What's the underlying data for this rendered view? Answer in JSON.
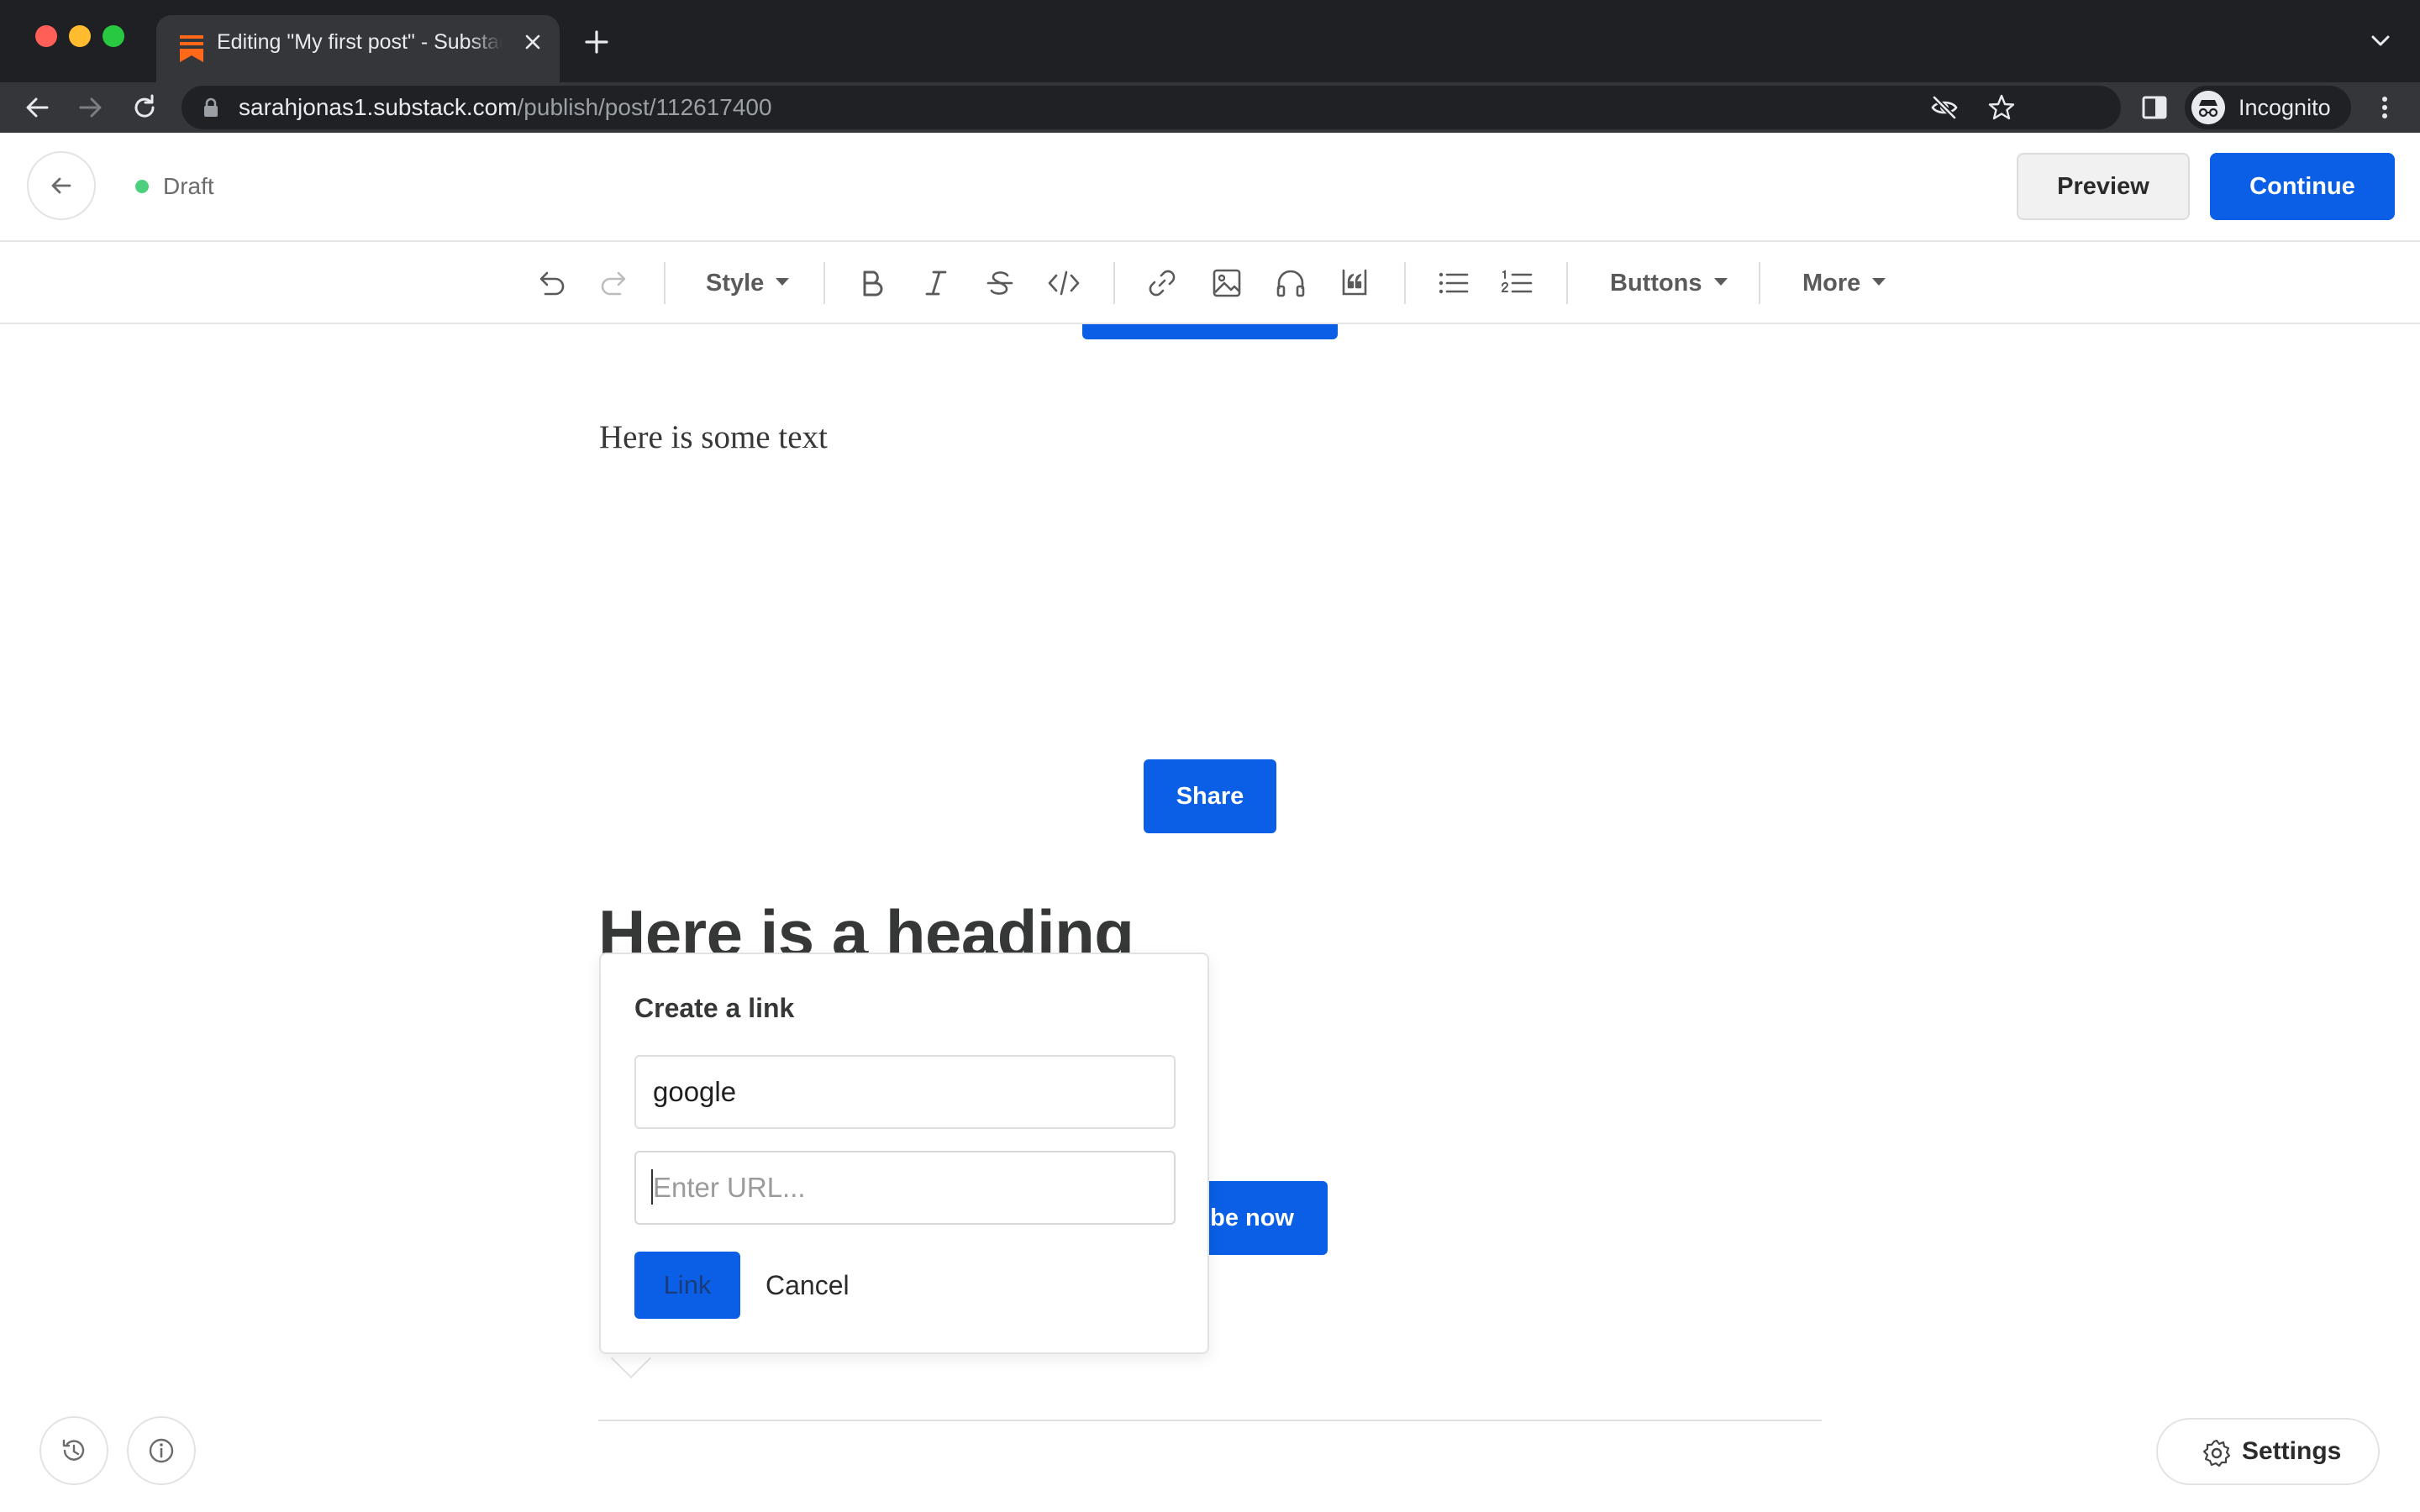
{
  "browser": {
    "tab_title": "Editing \"My first post\" - Substack",
    "url_host": "sarahjonas1.substack.com",
    "url_path": "/publish/post/112617400",
    "profile_label": "Incognito"
  },
  "header": {
    "status": "Draft",
    "preview_label": "Preview",
    "continue_label": "Continue"
  },
  "toolbar": {
    "style_label": "Style",
    "buttons_label": "Buttons",
    "more_label": "More"
  },
  "content": {
    "paragraph": "Here is some text",
    "share_label": "Share",
    "heading": "Here is a heading",
    "subscribe_visible": "ibe now"
  },
  "link_popover": {
    "title": "Create a link",
    "text_value": "google",
    "url_placeholder": "Enter URL...",
    "link_label": "Link",
    "cancel_label": "Cancel"
  },
  "footer": {
    "settings_label": "Settings"
  },
  "colors": {
    "accent": "#0a5fe6",
    "draft_dot": "#4cd07d",
    "chrome_dark": "#1f2023"
  },
  "icons": [
    "substack-logo-icon",
    "close-icon",
    "plus-icon",
    "chevron-down-icon",
    "back-arrow-icon",
    "forward-arrow-icon",
    "reload-icon",
    "lock-icon",
    "eye-off-icon",
    "star-icon",
    "sidebar-icon",
    "incognito-icon",
    "kebab-menu-icon",
    "undo-icon",
    "redo-icon",
    "bold-icon",
    "italic-icon",
    "strikethrough-icon",
    "code-icon",
    "link-icon",
    "image-icon",
    "headphones-icon",
    "quote-icon",
    "bullet-list-icon",
    "numbered-list-icon",
    "history-icon",
    "info-icon",
    "gear-icon"
  ]
}
